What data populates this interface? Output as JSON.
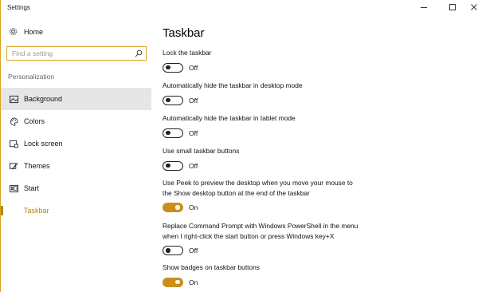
{
  "window": {
    "title": "Settings",
    "controls": {
      "minimize_icon": "minimize-icon",
      "maximize_icon": "maximize-icon",
      "close_icon": "close-icon"
    }
  },
  "sidebar": {
    "home": {
      "label": "Home",
      "icon": "gear-icon"
    },
    "search": {
      "placeholder": "Find a setting",
      "icon": "search-icon"
    },
    "section_label": "Personalization",
    "items": [
      {
        "label": "Background",
        "icon": "picture-icon",
        "selected": true,
        "active": false
      },
      {
        "label": "Colors",
        "icon": "palette-icon",
        "selected": false,
        "active": false
      },
      {
        "label": "Lock screen",
        "icon": "lock-screen-icon",
        "selected": false,
        "active": false
      },
      {
        "label": "Themes",
        "icon": "brush-icon",
        "selected": false,
        "active": false
      },
      {
        "label": "Start",
        "icon": "start-icon",
        "selected": false,
        "active": false
      },
      {
        "label": "Taskbar",
        "icon": "taskbar-icon",
        "selected": false,
        "active": true
      }
    ]
  },
  "main": {
    "title": "Taskbar",
    "settings": [
      {
        "label": "Lock the taskbar",
        "state": "Off",
        "on": false
      },
      {
        "label": "Automatically hide the taskbar in desktop mode",
        "state": "Off",
        "on": false
      },
      {
        "label": "Automatically hide the taskbar in tablet mode",
        "state": "Off",
        "on": false
      },
      {
        "label": "Use small taskbar buttons",
        "state": "Off",
        "on": false
      },
      {
        "label_lines": [
          "Use Peek to preview the desktop when you move your mouse to",
          "the Show desktop button at the end of the taskbar"
        ],
        "state": "On",
        "on": true
      },
      {
        "label_lines": [
          "Replace Command Prompt with Windows PowerShell in the menu",
          "when I right-click the start button or press Windows key+X"
        ],
        "state": "Off",
        "on": false
      },
      {
        "label": "Show badges on taskbar buttons",
        "state": "On",
        "on": true
      }
    ]
  },
  "colors": {
    "accent": "#c98f1b",
    "accent_text": "#b8860b",
    "selected_bg": "#e6e6e6"
  }
}
